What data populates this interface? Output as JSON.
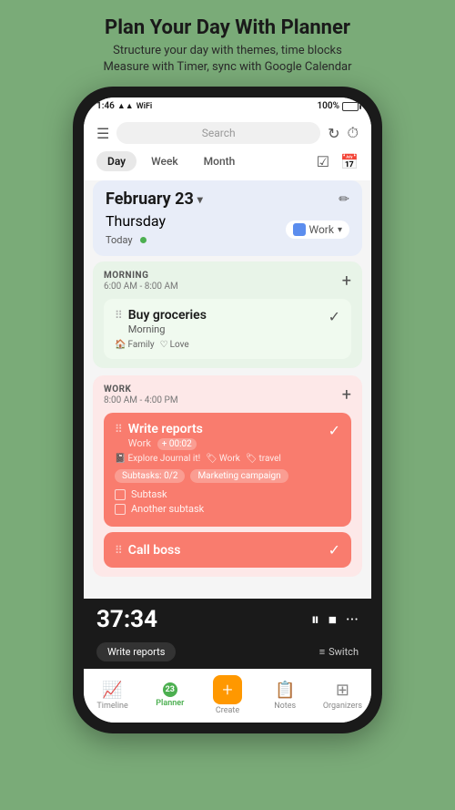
{
  "header": {
    "title": "Plan Your Day With Planner",
    "subtitle": "Structure your day with themes, time blocks\nMeasure with Timer, sync with Google Calendar"
  },
  "status_bar": {
    "time": "1:46",
    "battery": "100%",
    "icons": "signal wifi battery"
  },
  "search": {
    "placeholder": "Search"
  },
  "period_tabs": {
    "day": "Day",
    "week": "Week",
    "month": "Month",
    "active": "Day"
  },
  "date_header": {
    "date": "February 23",
    "day": "Thursday",
    "today": "Today",
    "workspace": "Work"
  },
  "morning_block": {
    "label": "MORNING",
    "time_range": "6:00 AM - 8:00 AM",
    "task": {
      "title": "Buy groceries",
      "subtitle": "Morning",
      "tags": [
        "Family",
        "Love"
      ],
      "checked": true
    }
  },
  "work_block": {
    "label": "WORK",
    "time_range": "8:00 AM - 4:00 PM",
    "tasks": [
      {
        "title": "Write reports",
        "subtitle": "Work",
        "time_extra": "+ 00:02",
        "tags": [
          "Explore Journal it!",
          "Work",
          "travel"
        ],
        "subtask_chips": [
          "Subtasks: 0/2",
          "Marketing campaign"
        ],
        "subtasks": [
          "Subtask",
          "Another subtask"
        ],
        "checked": true
      },
      {
        "title": "Call boss",
        "checked": true
      }
    ]
  },
  "timer": {
    "time": "37:34",
    "task_label": "Write reports",
    "switch_label": "Switch"
  },
  "bottom_nav": {
    "items": [
      {
        "label": "Timeline",
        "icon": "📈",
        "active": false
      },
      {
        "label": "Planner",
        "icon": "23",
        "active": true
      },
      {
        "label": "Create",
        "icon": "+",
        "active": false
      },
      {
        "label": "Notes",
        "icon": "📋",
        "active": false
      },
      {
        "label": "Organizers",
        "icon": "⊞",
        "active": false
      }
    ]
  }
}
